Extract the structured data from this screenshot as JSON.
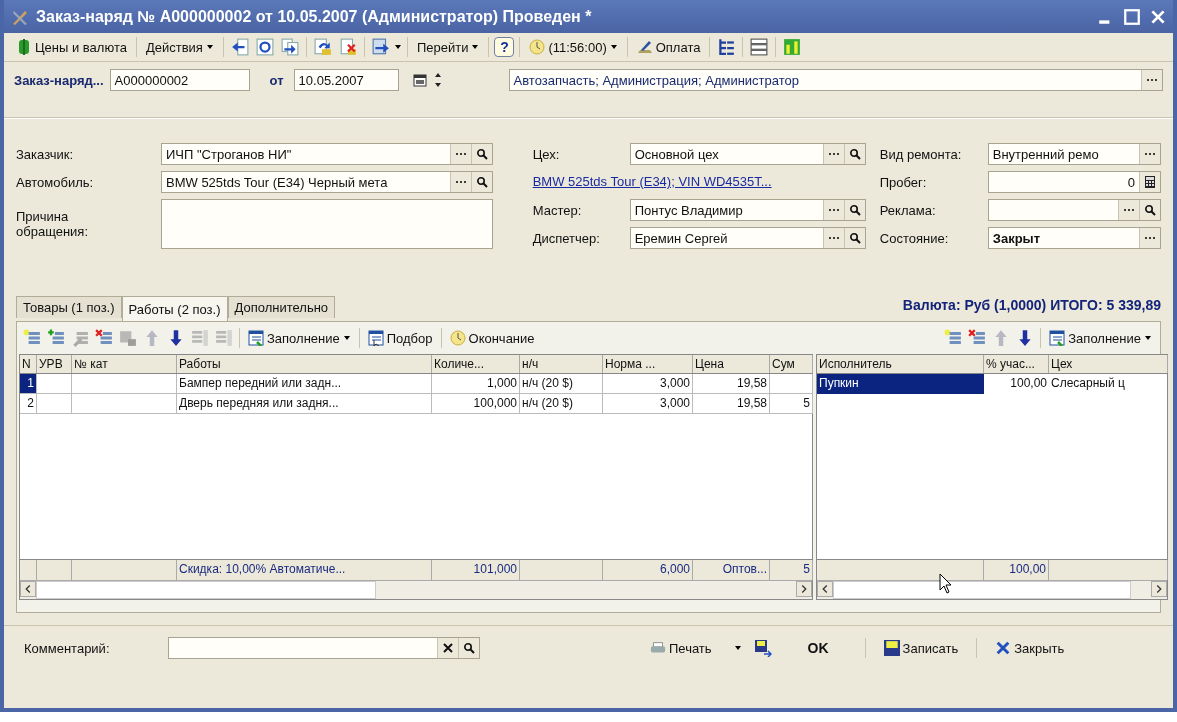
{
  "window": {
    "title": "Заказ-наряд № A000000002 от 10.05.2007 (Администратор) Проведен *"
  },
  "toolbar": {
    "prices": "Цены и валюта",
    "actions": "Действия",
    "goto": "Перейти",
    "help": "?",
    "time": "(11:56:00)",
    "payment": "Оплата"
  },
  "header": {
    "doc_label": "Заказ-наряд...",
    "number": "A000000002",
    "date_label": "от",
    "date": "10.05.2007",
    "organization": "Автозапчасть; Администрация; Администратор"
  },
  "form": {
    "columns": [
      [
        {
          "kind": "select_search",
          "label": "Заказчик:",
          "value": "ИЧП \"Строганов НИ\"",
          "emphasis": false
        },
        {
          "kind": "select_search",
          "label": "Автомобиль:",
          "value": "BMW 525tds Tour (E34) Черный мета",
          "emphasis": false
        },
        {
          "kind": "memo",
          "label": "Причина обращения:"
        }
      ],
      [
        {
          "kind": "select_search",
          "label": "Цех:",
          "value": "Основной цех",
          "emphasis": false
        },
        {
          "kind": "link",
          "value": "BMW 525tds Tour (E34); VIN WD4535T..."
        },
        {
          "kind": "select_search",
          "label": "Мастер:",
          "value": "Понтус Владимир",
          "emphasis": false
        },
        {
          "kind": "select_search",
          "label": "Диспетчер:",
          "value": "Еремин Сергей",
          "emphasis": false
        }
      ],
      [
        {
          "kind": "select",
          "label": "Вид ремонта:",
          "value": "Внутренний ремо",
          "emphasis": false
        },
        {
          "kind": "number",
          "label": "Пробег:",
          "value": "0",
          "emphasis": false
        },
        {
          "kind": "select_search",
          "label": "Реклама:"
        },
        {
          "kind": "select",
          "label": "Состояние:",
          "value": "Закрыт",
          "emphasis": true
        }
      ]
    ]
  },
  "tabs": [
    {
      "label": "Товары (1 поз.)",
      "selected": false
    },
    {
      "label": "Работы (2 поз.)",
      "selected": true
    },
    {
      "label": "Дополнительно",
      "selected": false
    }
  ],
  "total": "Валюта: Руб (1,0000) ИТОГО: 5 339,89",
  "works_toolbar": {
    "fill": "Заполнение",
    "pick": "Подбор",
    "finish": "Окончание"
  },
  "performers_toolbar": {
    "fill": "Заполнение"
  },
  "works": {
    "columns": [
      "N",
      "УРВ",
      "№ кат",
      "Работы",
      "Количе...",
      "н/ч",
      "Норма ...",
      "Цена",
      "Сум"
    ],
    "rows": [
      {
        "n": "1",
        "work": "Бампер передний или задн...",
        "qty": "1,000",
        "unit": "н/ч (20 $)",
        "norm": "3,000",
        "price": "19,58",
        "selected": true
      },
      {
        "n": "2",
        "work": "Дверь передняя или задня...",
        "qty": "100,000",
        "unit": "н/ч (20 $)",
        "norm": "3,000",
        "price": "19,58",
        "sum": "5",
        "selected": false
      }
    ],
    "footer": {
      "work": "Скидка: 10,00% Автоматиче...",
      "qty": "101,000",
      "norm": "6,000",
      "price": "Оптов...",
      "sum": "5"
    }
  },
  "performers": {
    "columns": [
      "Исполнитель",
      "% учас...",
      "Цех"
    ],
    "rows": [
      {
        "name": "Пупкин",
        "share": "100,00",
        "shop": "Слесарный ц",
        "selected": true
      }
    ],
    "footer": {
      "share": "100,00"
    }
  },
  "bottom": {
    "comment_label": "Комментарий:",
    "print": "Печать",
    "ok": "OK",
    "save": "Записать",
    "close": "Закрыть"
  }
}
